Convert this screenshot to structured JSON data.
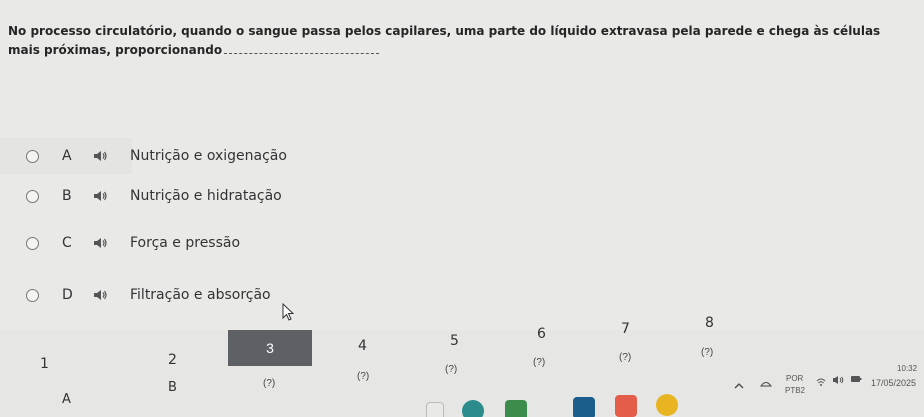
{
  "question": {
    "text": "No processo circulatório, quando o sangue passa pelos capilares, uma parte do líquido extravasa pela parede e chega às células mais próximas, proporcionando"
  },
  "options": [
    {
      "letter": "A",
      "text": "Nutrição e oxigenação"
    },
    {
      "letter": "B",
      "text": "Nutrição e hidratação"
    },
    {
      "letter": "C",
      "text": "Força e pressão"
    },
    {
      "letter": "D",
      "text": "Filtração e absorção"
    }
  ],
  "navigation": {
    "numbers": [
      "1",
      "2",
      "3",
      "4",
      "5",
      "6",
      "7",
      "8"
    ],
    "active_number": "3",
    "status_labels": [
      "(?)",
      "(?)",
      "(?)",
      "(?)",
      "(?)",
      "(?)"
    ],
    "answer_labels": [
      "A",
      "B"
    ]
  },
  "system_tray": {
    "language": "POR",
    "layout": "PTB2",
    "time": "10:32",
    "date": "17/05/2025"
  },
  "colors": {
    "background": "#e9e9e7",
    "active_number_bg": "#5d6064",
    "radio_border": "#777777"
  },
  "icons": [
    "speaker-icon",
    "mouse-cursor-icon",
    "chevron-up-icon",
    "network-icon",
    "volume-icon",
    "wifi-icon"
  ]
}
